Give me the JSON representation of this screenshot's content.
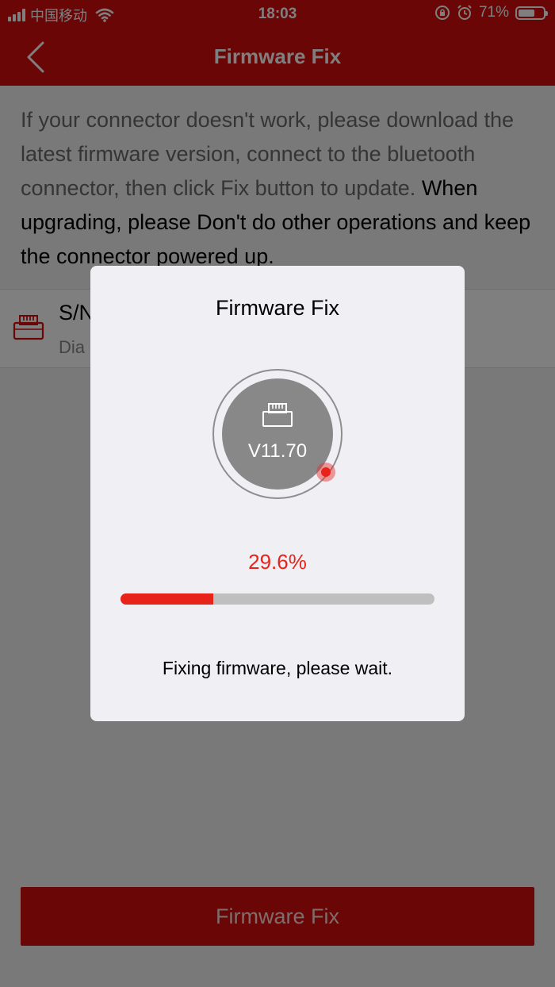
{
  "status_bar": {
    "carrier": "中国移动",
    "time": "18:03",
    "battery_percent_label": "71%",
    "battery_level": 0.71
  },
  "nav": {
    "title": "Firmware Fix"
  },
  "description": {
    "normal": "If your connector doesn't work, please download the latest firmware version, connect to the bluetooth connector, then click Fix button to update.",
    "emphasis": " When upgrading, please Don't do other operations and keep the connector powered up."
  },
  "device": {
    "sn_label": "S/N",
    "sub_label": "Dia"
  },
  "bottom_button": {
    "label": "Firmware Fix"
  },
  "dialog": {
    "title": "Firmware Fix",
    "version": "V11.70",
    "percent_label": "29.6%",
    "progress": 0.296,
    "message": "Fixing firmware, please wait."
  },
  "colors": {
    "brand_red": "#d50d0d",
    "progress_red": "#e8231a",
    "track_gray": "#bfbfbf"
  },
  "icons": {
    "back": "chevron-left-icon",
    "device": "obd-connector-icon",
    "wifi": "wifi-icon",
    "lock_rotation": "orientation-lock-icon",
    "alarm": "alarm-icon"
  }
}
